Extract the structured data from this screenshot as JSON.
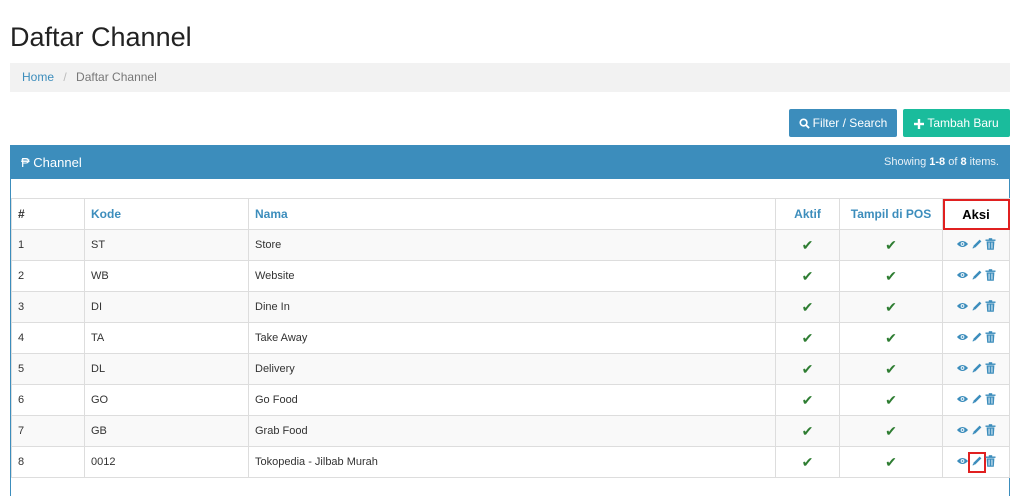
{
  "page": {
    "title": "Daftar Channel"
  },
  "breadcrumb": {
    "home": "Home",
    "separator": "/",
    "current": "Daftar Channel"
  },
  "buttons": {
    "filter": "Filter / Search",
    "add": "Tambah Baru"
  },
  "panel": {
    "title": "₱ Channel",
    "summary_prefix": "Showing ",
    "summary_range": "1-8",
    "summary_of": " of ",
    "summary_total": "8",
    "summary_suffix": " items."
  },
  "table": {
    "columns": [
      "#",
      "Kode",
      "Nama",
      "Aktif",
      "Tampil di POS",
      "Aksi"
    ],
    "rows": [
      {
        "no": "1",
        "kode": "ST",
        "nama": "Store",
        "aktif": "✔",
        "pos": "✔"
      },
      {
        "no": "2",
        "kode": "WB",
        "nama": "Website",
        "aktif": "✔",
        "pos": "✔"
      },
      {
        "no": "3",
        "kode": "DI",
        "nama": "Dine In",
        "aktif": "✔",
        "pos": "✔"
      },
      {
        "no": "4",
        "kode": "TA",
        "nama": "Take Away",
        "aktif": "✔",
        "pos": "✔"
      },
      {
        "no": "5",
        "kode": "DL",
        "nama": "Delivery",
        "aktif": "✔",
        "pos": "✔"
      },
      {
        "no": "6",
        "kode": "GO",
        "nama": "Go Food",
        "aktif": "✔",
        "pos": "✔"
      },
      {
        "no": "7",
        "kode": "GB",
        "nama": "Grab Food",
        "aktif": "✔",
        "pos": "✔"
      },
      {
        "no": "8",
        "kode": "0012",
        "nama": "Tokopedia - Jilbab Murah",
        "aktif": "✔",
        "pos": "✔"
      }
    ],
    "action_icons": [
      "eye-icon",
      "pencil-icon",
      "trash-icon"
    ]
  },
  "colors": {
    "primary": "#3c8dbc",
    "success": "#1abc9c",
    "check": "#2e7d32",
    "highlight": "#e02020"
  }
}
